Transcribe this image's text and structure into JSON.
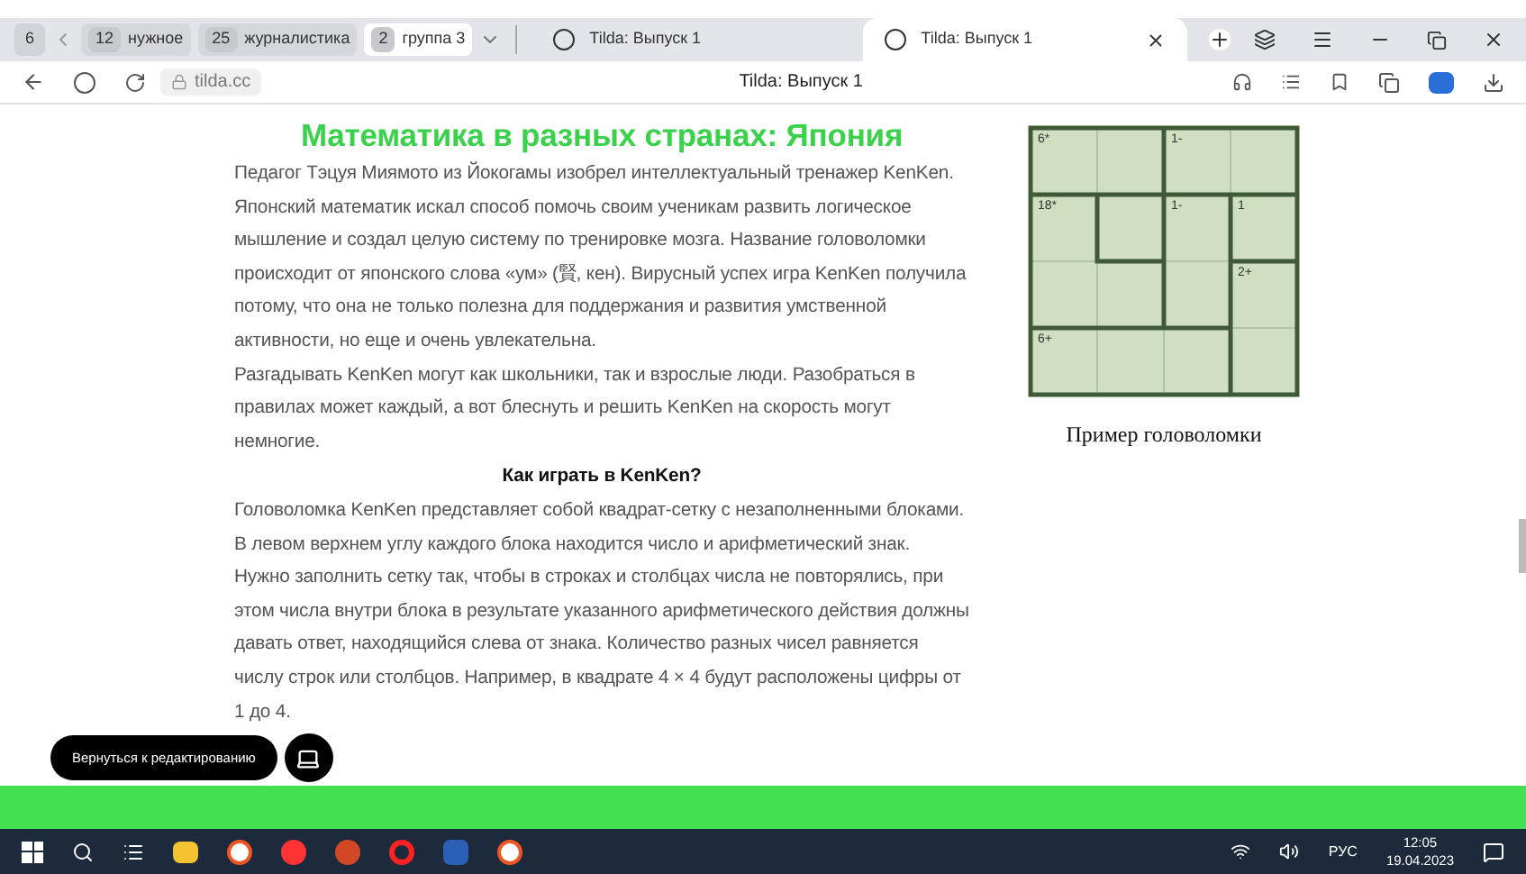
{
  "tab_strip": {
    "counter": "6",
    "groups": [
      {
        "count": "12",
        "label": "нужное",
        "selected": false
      },
      {
        "count": "25",
        "label": "журналистика",
        "selected": false
      },
      {
        "count": "2",
        "label": "группа 3",
        "selected": true
      }
    ],
    "tabs": [
      {
        "title": "Tilda: Выпуск 1",
        "selected": false
      },
      {
        "title": "Tilda: Выпуск 1",
        "selected": true
      }
    ]
  },
  "address_bar": {
    "url": "tilda.cc",
    "page_title": "Tilda: Выпуск 1"
  },
  "article": {
    "title": "Математика в разных странах: Япония",
    "paragraphs": [
      "Педагог Тэцуя Миямото из Йокогамы изобрел интеллектуальный тренажер KenKen. Японский математик искал способ помочь своим ученикам развить логическое мышление и создал целую систему по тренировке мозга. Название головоломки происходит от японского слова «ум» (賢, кен). Вирусный успех игра KenKen получила потому, что она не только полезна для поддержания и развития умственной активности, но еще и очень увлекательна.",
      "Разгадывать KenKen могут как школьники, так и взрослые люди. Разобраться в правилах может каждый, а вот блеснуть и решить KenKen на скорость могут немногие."
    ],
    "subtitle": "Как играть в KenKen?",
    "paragraphs_2": [
      "Головоломка KenKen представляет собой квадрат-сетку с незаполненными блоками. В левом верхнем углу каждого блока находится число и арифметический знак. Нужно заполнить сетку так, чтобы в строках и столбцах числа не повторялись, при этом числа внутри блока в результате указанного арифметического действия должны давать ответ, находящийся слева от знака. Количество разных чисел равняется числу строк или столбцов. Например, в квадрате 4 × 4 будут расположены цифры от 1 до 4."
    ],
    "figure": {
      "cells": [
        {
          "clue": "6*"
        },
        {},
        {
          "clue": "1-"
        },
        {},
        {
          "clue": "18*"
        },
        {},
        {
          "clue": "1-"
        },
        {
          "clue": "1"
        },
        {},
        {},
        {},
        {
          "clue": "2+"
        },
        {
          "clue": "6+"
        },
        {},
        {},
        {}
      ],
      "caption": "Пример головоломки"
    }
  },
  "edit_button": "Вернуться к редактированию",
  "taskbar": {
    "language": "РУС",
    "time": "12:05",
    "date": "19.04.2023"
  }
}
